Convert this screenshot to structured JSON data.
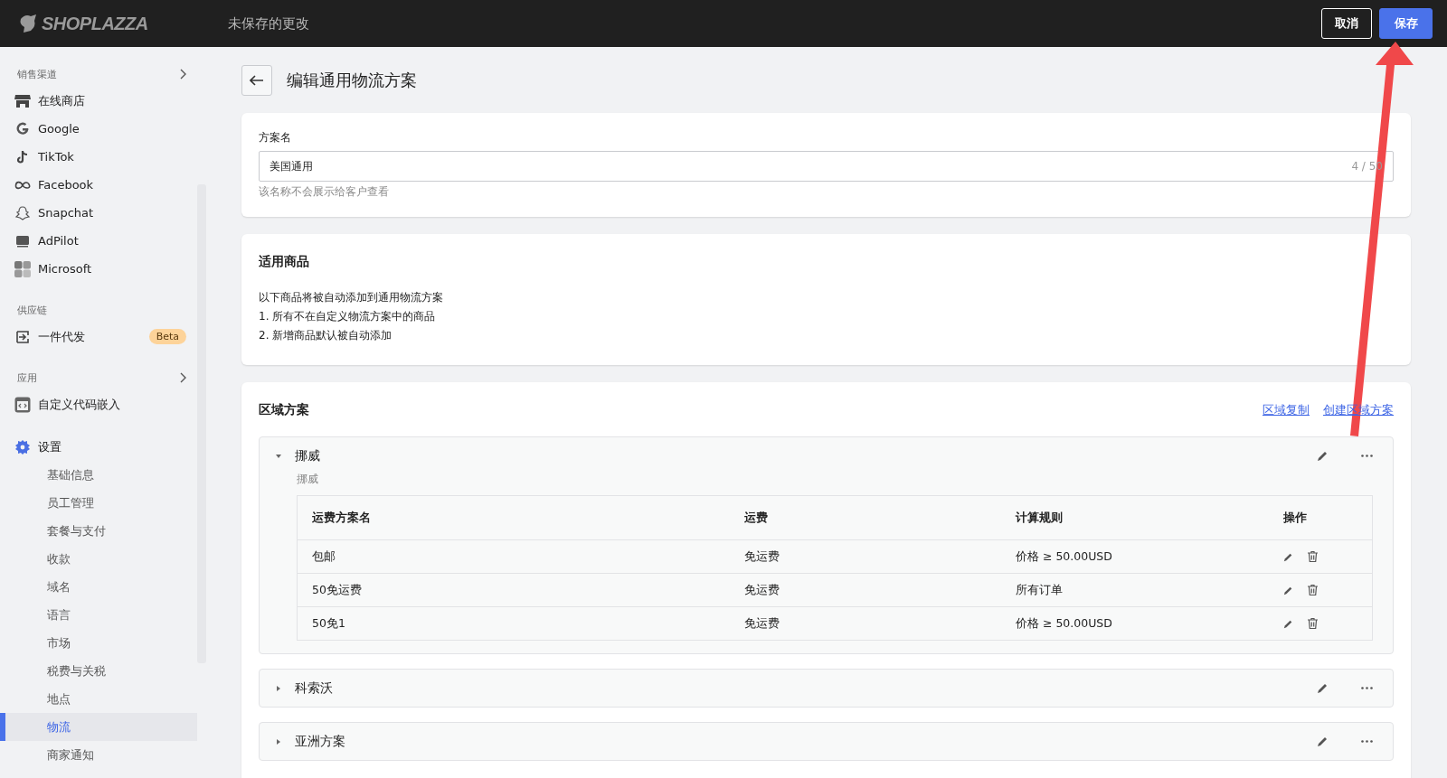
{
  "topbar": {
    "logo": "SHOPLAZZA",
    "status": "未保存的更改",
    "buttons": [
      {
        "label": "取消",
        "kind": "secondary"
      },
      {
        "label": "保存",
        "kind": "primary"
      }
    ]
  },
  "sidebar": {
    "sections": [
      {
        "title": "销售渠道",
        "chevron": true,
        "items": [
          {
            "label": "在线商店"
          },
          {
            "label": "Google"
          },
          {
            "label": "TikTok"
          },
          {
            "label": "Facebook"
          },
          {
            "label": "Snapchat"
          },
          {
            "label": "AdPilot"
          },
          {
            "label": "Microsoft"
          }
        ]
      },
      {
        "title": "供应链",
        "chevron": false,
        "items": [
          {
            "label": "一件代发",
            "badge": "Beta"
          }
        ]
      },
      {
        "title": "应用",
        "chevron": true,
        "items": [
          {
            "label": "自定义代码嵌入"
          }
        ]
      }
    ],
    "settings": {
      "label": "设置",
      "expanded": true,
      "children": [
        {
          "label": "基础信息",
          "selected": false
        },
        {
          "label": "员工管理",
          "selected": false
        },
        {
          "label": "套餐与支付",
          "selected": false
        },
        {
          "label": "收款",
          "selected": false
        },
        {
          "label": "域名",
          "selected": false
        },
        {
          "label": "语言",
          "selected": false
        },
        {
          "label": "市场",
          "selected": false
        },
        {
          "label": "税费与关税",
          "selected": false
        },
        {
          "label": "地点",
          "selected": false
        },
        {
          "label": "物流",
          "selected": true
        },
        {
          "label": "商家通知",
          "selected": false
        }
      ]
    }
  },
  "page": {
    "title": "编辑通用物流方案",
    "name_card": {
      "label": "方案名",
      "value": "美国通用",
      "counter": "4 / 50",
      "help": "该名称不会展示给客户查看"
    },
    "products_card": {
      "title": "适用商品",
      "lines": [
        "以下商品将被自动添加到通用物流方案",
        "1. 所有不在自定义物流方案中的商品",
        "2. 新增商品默认被自动添加"
      ]
    },
    "zones_card": {
      "title": "区域方案",
      "links": [
        "区域复制",
        "创建区域方案"
      ],
      "zones": [
        {
          "name": "挪威",
          "expanded": true,
          "subtitle": "挪威",
          "columns": [
            "运费方案名",
            "运费",
            "计算规则",
            "操作"
          ],
          "rows": [
            [
              "包邮",
              "免运费",
              "价格 ≥ 50.00USD"
            ],
            [
              "50免运费",
              "免运费",
              "所有订单"
            ],
            [
              "50免1",
              "免运费",
              "价格 ≥ 50.00USD"
            ]
          ]
        },
        {
          "name": "科索沃",
          "expanded": false
        },
        {
          "name": "亚洲方案",
          "expanded": false
        }
      ]
    }
  }
}
